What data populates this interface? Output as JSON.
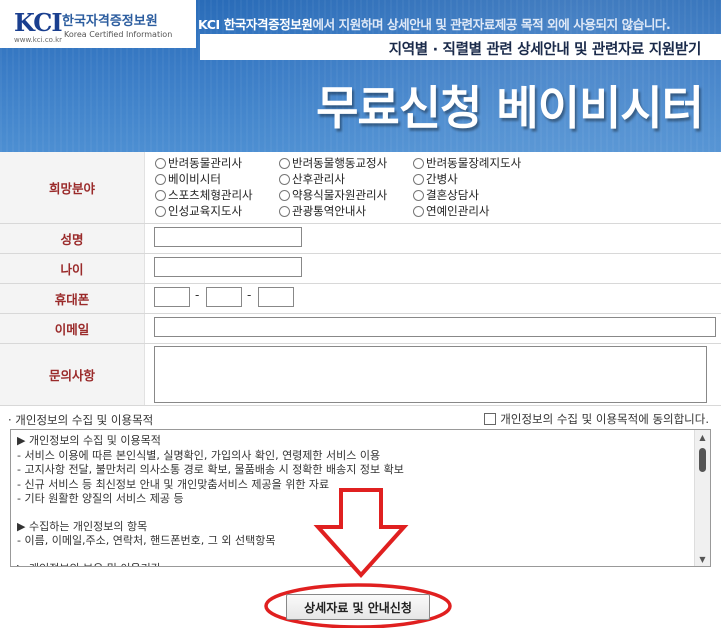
{
  "banner": {
    "logo_mark": "KCI",
    "logo_sub": "www.kci.co.kr",
    "logo_name": "한국자격증정보원",
    "logo_en": "Korea Certified Information",
    "notice_org": "KCI 한국자격증정보원",
    "notice_rest": "에서 지원하며 상세안내 및 관련자료제공 목적 외에 사용되지 않습니다.",
    "subtitle": "지역별 · 직렬별 관련 상세안내 및 관련자료 지원받기",
    "title": "무료신청 베이비시터"
  },
  "form": {
    "field_label": "희망분야",
    "field_options": [
      "반려동물관리사",
      "반려동물행동교정사",
      "반려동물장례지도사",
      "베이비시터",
      "산후관리사",
      "간병사",
      "스포츠체형관리사",
      "약용식물자원관리사",
      "결혼상담사",
      "인성교육지도사",
      "관광통역안내사",
      "연예인관리사"
    ],
    "name_label": "성명",
    "age_label": "나이",
    "phone_label": "휴대폰",
    "phone_separator": "-",
    "email_label": "이메일",
    "inquiry_label": "문의사항"
  },
  "privacy": {
    "heading": "· 개인정보의 수집 및 이용목적",
    "agree_label": "개인정보의 수집 및 이용목적에 동의합니다.",
    "lines": [
      "▶ 개인정보의 수집 및 이용목적",
      "- 서비스 이용에 따른 본인식별, 실명확인, 가입의사 확인, 연령제한 서비스 이용",
      "- 고지사항 전달, 불만처리 의사소통 경로 확보, 물품배송 시 정확한 배송지 정보 확보",
      "- 신규 서비스 등 최신정보 안내 및 개인맞춤서비스 제공을 위한 자료",
      "- 기타 원활한 양질의 서비스 제공 등",
      "",
      "▶ 수집하는 개인정보의 항목",
      "- 이름, 이메일,주소, 연락처, 핸드폰번호, 그 외 선택항목",
      "",
      "▶ 개인정보의 보유 및 이용기간"
    ],
    "scroll_up": "▲",
    "scroll_down": "▼"
  },
  "submit": {
    "label": "상세자료 및 안내신청"
  },
  "annotation": {
    "color": "#e02020"
  }
}
